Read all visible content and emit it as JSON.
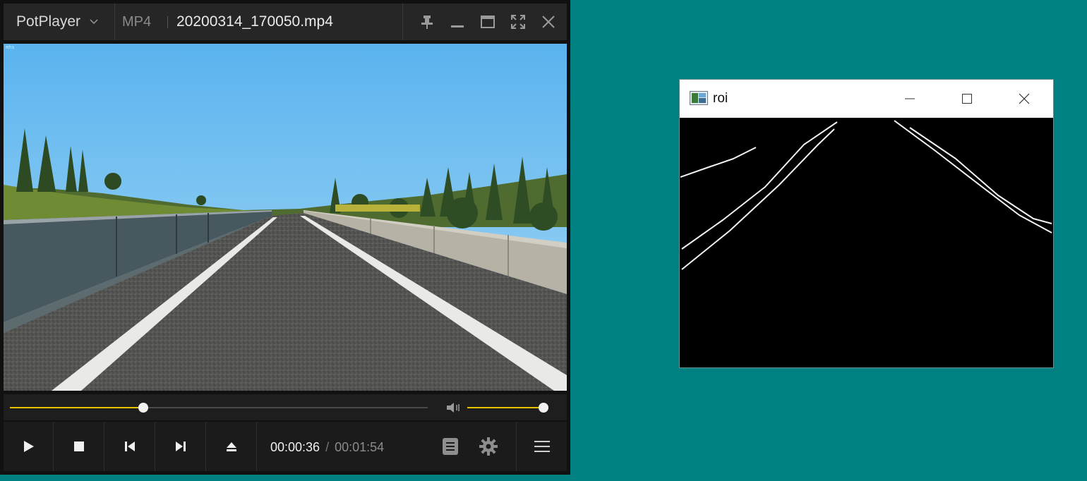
{
  "player": {
    "app_name": "PotPlayer",
    "format": "MP4",
    "file_name": "20200314_170050.mp4",
    "video_corner_text": "mhs",
    "playback": {
      "current_time": "00:00:36",
      "separator": "/",
      "total_time": "00:01:54",
      "progress_fraction": 0.32
    },
    "volume_fraction": 0.96,
    "window_controls": [
      "pin-icon",
      "minimize-icon",
      "maximize-icon",
      "fullscreen-icon",
      "close-icon"
    ],
    "control_buttons": [
      "play-icon",
      "stop-icon",
      "previous-icon",
      "next-icon",
      "eject-icon"
    ],
    "right_buttons": [
      "playlist-icon",
      "gear-icon",
      "menu-icon"
    ],
    "accent_color": "#e8c400"
  },
  "roi_window": {
    "title": "roi",
    "controls": [
      "minimize-icon",
      "maximize-icon",
      "close-icon"
    ]
  },
  "colors": {
    "desktop": "#008080",
    "player_bg": "#1b1b1b",
    "title_bg": "#262626"
  }
}
